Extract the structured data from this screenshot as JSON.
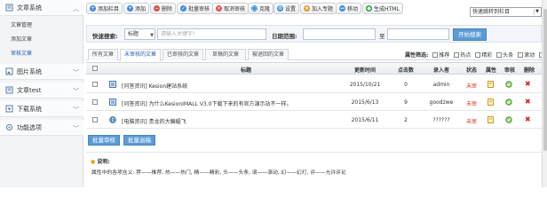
{
  "sidebar": {
    "sections": [
      {
        "label": "文章系统",
        "icon": "document-icon"
      },
      {
        "label": "图片系统",
        "icon": "image-icon"
      },
      {
        "label": "文章test",
        "icon": "document-icon"
      },
      {
        "label": "下载系统",
        "icon": "download-icon"
      },
      {
        "label": "功能选项",
        "icon": "settings-icon"
      }
    ],
    "sub_items": [
      {
        "label": "文章管理"
      },
      {
        "label": "添加文章"
      },
      {
        "label": "审核文章"
      }
    ]
  },
  "toolbar": {
    "buttons": [
      {
        "label": "添加栏目",
        "color": "#3c8dd9"
      },
      {
        "label": "添加",
        "color": "#3c8dd9"
      },
      {
        "label": "删除",
        "color": "#d9534f"
      },
      {
        "label": "批量审核",
        "color": "#3c8dd9"
      },
      {
        "label": "取消审核",
        "color": "#d9534f"
      },
      {
        "label": "克隆",
        "color": "#3c8dd9"
      },
      {
        "label": "设置",
        "color": "#3c8dd9"
      },
      {
        "label": "加入专题",
        "color": "#e89a1c"
      },
      {
        "label": "移动",
        "color": "#3c8dd9"
      },
      {
        "label": "生成HTML",
        "color": "#2f9e44"
      }
    ],
    "jump_select": "快速跳转到栏目"
  },
  "search": {
    "label": "快速搜索:",
    "field_select": "标题",
    "keyword_placeholder": "请输入关键字!",
    "date_label": "日期范围:",
    "date_sep": "至",
    "submit_label": "开始搜索"
  },
  "tabs": [
    {
      "label": "所有文章"
    },
    {
      "label": "未审核的文章"
    },
    {
      "label": "已审核的文章"
    },
    {
      "label": "草稿的文章"
    },
    {
      "label": "被退回的文章"
    }
  ],
  "attributes": {
    "label": "属性筛选:",
    "options": [
      "推荐",
      "热点",
      "精彩",
      "头条",
      "滚动",
      "幻灯"
    ]
  },
  "table": {
    "headers": [
      "标题",
      "更新时间",
      "点击数",
      "录入者",
      "状态",
      "属性",
      "审核",
      "删除"
    ],
    "rows": [
      {
        "title": "[问答资讯] Kesion建站系统",
        "date": "2015/10/21",
        "clicks": "0",
        "author": "admin",
        "status": "未审"
      },
      {
        "title": "[问答资讯] 为什么KesionIMALL V3.0下载下来的有官方演示站不一样。",
        "date": "2015/6/13",
        "clicks": "9",
        "author": "goodzwe",
        "status": "未审"
      },
      {
        "title": "[电脑资讯] 贵龙的大蝙蝠飞",
        "date": "2015/6/11",
        "clicks": "2",
        "author": "??????",
        "status": "未审"
      }
    ]
  },
  "bulk": {
    "approve_label": "批量审核",
    "reject_label": "批量退稿"
  },
  "note": {
    "title": "说明:",
    "text": "属性中的各项含义:  荐——推荐,  热——热门,  精——精彩,  头——头条,  滚——滚动,  幻——幻灯,  评——允许评论"
  }
}
